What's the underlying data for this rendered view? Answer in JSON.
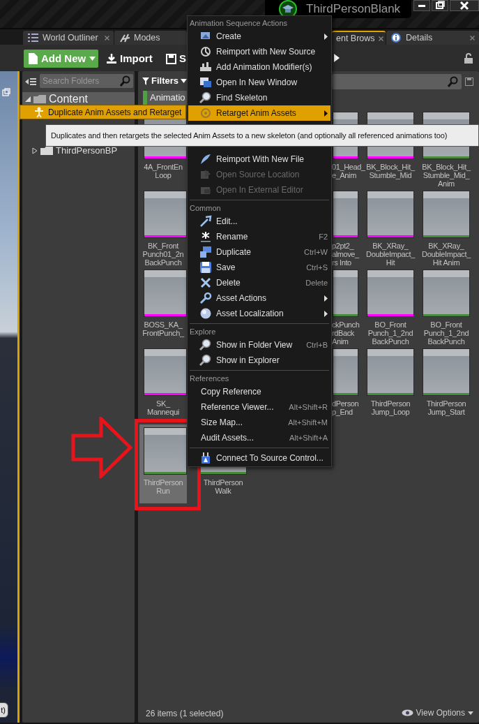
{
  "window": {
    "title": "ThirdPersonBlank"
  },
  "viewport": {
    "button": "t)"
  },
  "tabs": [
    {
      "label": "World Outliner",
      "selected": false,
      "closable": true
    },
    {
      "label": "Modes",
      "selected": false,
      "closable": false
    },
    {
      "label": "ent Brows",
      "selected": true,
      "closable": true
    },
    {
      "label": "Details",
      "selected": false,
      "closable": true
    }
  ],
  "toolbar": {
    "add_new": "Add New",
    "import": "Import",
    "save": "S"
  },
  "folders": {
    "placeholder": "Search Folders",
    "tree": [
      {
        "label": "Content",
        "expanded": true,
        "selected": true,
        "children": [
          {
            "label": "ThirdPersonBP",
            "expanded": false,
            "selected": false
          }
        ]
      }
    ]
  },
  "assets": {
    "filters": "Filters",
    "filter_chip": "Animatio",
    "status": "26 items (1 selected)",
    "view_options": "View Options",
    "rows": [
      [
        {
          "lines": [
            "4A_FrontEn",
            "Loop"
          ],
          "color": "#ff00ff",
          "selected": false
        },
        {
          "lines": [
            "01_Head_",
            "e_Anim"
          ],
          "color": "#ff00ff",
          "selected": false
        },
        {
          "lines": [
            "BK_Block_Hit_",
            "Stumble_Mid"
          ],
          "color": "#ff00ff",
          "selected": false
        },
        {
          "lines": [
            "BK_Block_Hit_",
            "Stumble_Mid_",
            "Anim"
          ],
          "color": "#4a8a3c",
          "selected": false
        }
      ],
      [
        {
          "lines": [
            "BK_Front",
            "Punch01_2n",
            "BackPunch"
          ],
          "color": "#ff00ff",
          "selected": false
        },
        {
          "lines": [
            "p2pt2_",
            "almove_",
            "rs Into"
          ],
          "color": "#ff00ff",
          "selected": false
        },
        {
          "lines": [
            "BK_XRay_",
            "DoubleImpact_",
            "Hit"
          ],
          "color": "#ff00ff",
          "selected": false
        },
        {
          "lines": [
            "BK_XRay_",
            "DoubleImpact_",
            "Hit Anim"
          ],
          "color": "#4a8a3c",
          "selected": false
        }
      ],
      [
        {
          "lines": [
            "BOSS_KA_",
            "FrontPunch_"
          ],
          "color": "#ff00ff",
          "selected": false
        },
        {
          "lines": [
            "ckPunch",
            "rdBack",
            "Anim"
          ],
          "color": "#4a8a3c",
          "selected": false
        },
        {
          "lines": [
            "BO_Front",
            "Punch_1_2nd",
            "BackPunch"
          ],
          "color": "#ff00ff",
          "selected": false
        },
        {
          "lines": [
            "BO_Front",
            "Punch_1_2nd",
            "BackPunch"
          ],
          "color": "#4a8a3c",
          "selected": false
        }
      ],
      [
        {
          "lines": [
            "SK_",
            "Mannequi"
          ],
          "color": "#ff00ff",
          "selected": false
        },
        {
          "lines": [
            "dPerson",
            "p_End"
          ],
          "color": "#4a8a3c",
          "selected": false
        },
        {
          "lines": [
            "ThirdPerson",
            "Jump_Loop"
          ],
          "color": "#4a8a3c",
          "selected": false
        },
        {
          "lines": [
            "ThirdPerson",
            "Jump_Start"
          ],
          "color": "#4a8a3c",
          "selected": false
        }
      ],
      [
        {
          "lines": [
            "ThirdPerson",
            "Run"
          ],
          "color": "#4a8a3c",
          "selected": true
        },
        {
          "lines": [
            "ThirdPerson",
            "Walk"
          ],
          "color": "#4a8a3c",
          "selected": false
        }
      ]
    ]
  },
  "context_menu": {
    "sections": [
      {
        "title": "Animation Sequence Actions",
        "items": [
          {
            "label": "Create",
            "submenu": true,
            "highlighted": false,
            "disabled": false
          },
          {
            "label": "Reimport with New Source",
            "submenu": false,
            "highlighted": false,
            "disabled": false
          },
          {
            "label": "Add Animation Modifier(s)",
            "submenu": false,
            "highlighted": false,
            "disabled": false
          },
          {
            "label": "Open In New Window",
            "submenu": false,
            "highlighted": false,
            "disabled": false
          },
          {
            "label": "Find Skeleton",
            "submenu": false,
            "highlighted": false,
            "disabled": false
          },
          {
            "label": "Retarget Anim Assets",
            "submenu": true,
            "highlighted": true,
            "disabled": false
          },
          {
            "label": "Reimport With New File",
            "submenu": false,
            "highlighted": false,
            "disabled": false
          },
          {
            "label": "Open Source Location",
            "submenu": false,
            "highlighted": false,
            "disabled": true
          },
          {
            "label": "Open In External Editor",
            "submenu": false,
            "highlighted": false,
            "disabled": true
          }
        ]
      },
      {
        "title": "Common",
        "items": [
          {
            "label": "Edit...",
            "submenu": false,
            "highlighted": false,
            "disabled": false
          },
          {
            "label": "Rename",
            "shortcut": "F2",
            "submenu": false,
            "highlighted": false,
            "disabled": false
          },
          {
            "label": "Duplicate",
            "shortcut": "Ctrl+W",
            "submenu": false,
            "highlighted": false,
            "disabled": false
          },
          {
            "label": "Save",
            "shortcut": "Ctrl+S",
            "submenu": false,
            "highlighted": false,
            "disabled": false
          },
          {
            "label": "Delete",
            "shortcut": "Delete",
            "submenu": false,
            "highlighted": false,
            "disabled": false
          },
          {
            "label": "Asset Actions",
            "submenu": true,
            "highlighted": false,
            "disabled": false
          },
          {
            "label": "Asset Localization",
            "submenu": true,
            "highlighted": false,
            "disabled": false
          }
        ]
      },
      {
        "title": "Explore",
        "items": [
          {
            "label": "Show in Folder View",
            "shortcut": "Ctrl+B",
            "submenu": false,
            "highlighted": false,
            "disabled": false
          },
          {
            "label": "Show in Explorer",
            "submenu": false,
            "highlighted": false,
            "disabled": false
          }
        ]
      },
      {
        "title": "References",
        "items": [
          {
            "label": "Copy Reference",
            "submenu": false,
            "highlighted": false,
            "disabled": false
          },
          {
            "label": "Reference Viewer...",
            "shortcut": "Alt+Shift+R",
            "submenu": false,
            "highlighted": false,
            "disabled": false
          },
          {
            "label": "Size Map...",
            "shortcut": "Alt+Shift+M",
            "submenu": false,
            "highlighted": false,
            "disabled": false
          },
          {
            "label": "Audit Assets...",
            "shortcut": "Alt+Shift+A",
            "submenu": false,
            "highlighted": false,
            "disabled": false
          }
        ]
      },
      {
        "items": [
          {
            "label": "Connect To Source Control...",
            "submenu": false,
            "highlighted": false,
            "disabled": false
          }
        ]
      }
    ]
  },
  "submenu": {
    "items": [
      {
        "label": "Duplicate Anim Assets and Retarget",
        "highlighted": true
      }
    ]
  },
  "tooltip": {
    "text": "Duplicates and then retargets the selected Anim Assets to a new skeleton (and optionally all referenced animations too)"
  }
}
